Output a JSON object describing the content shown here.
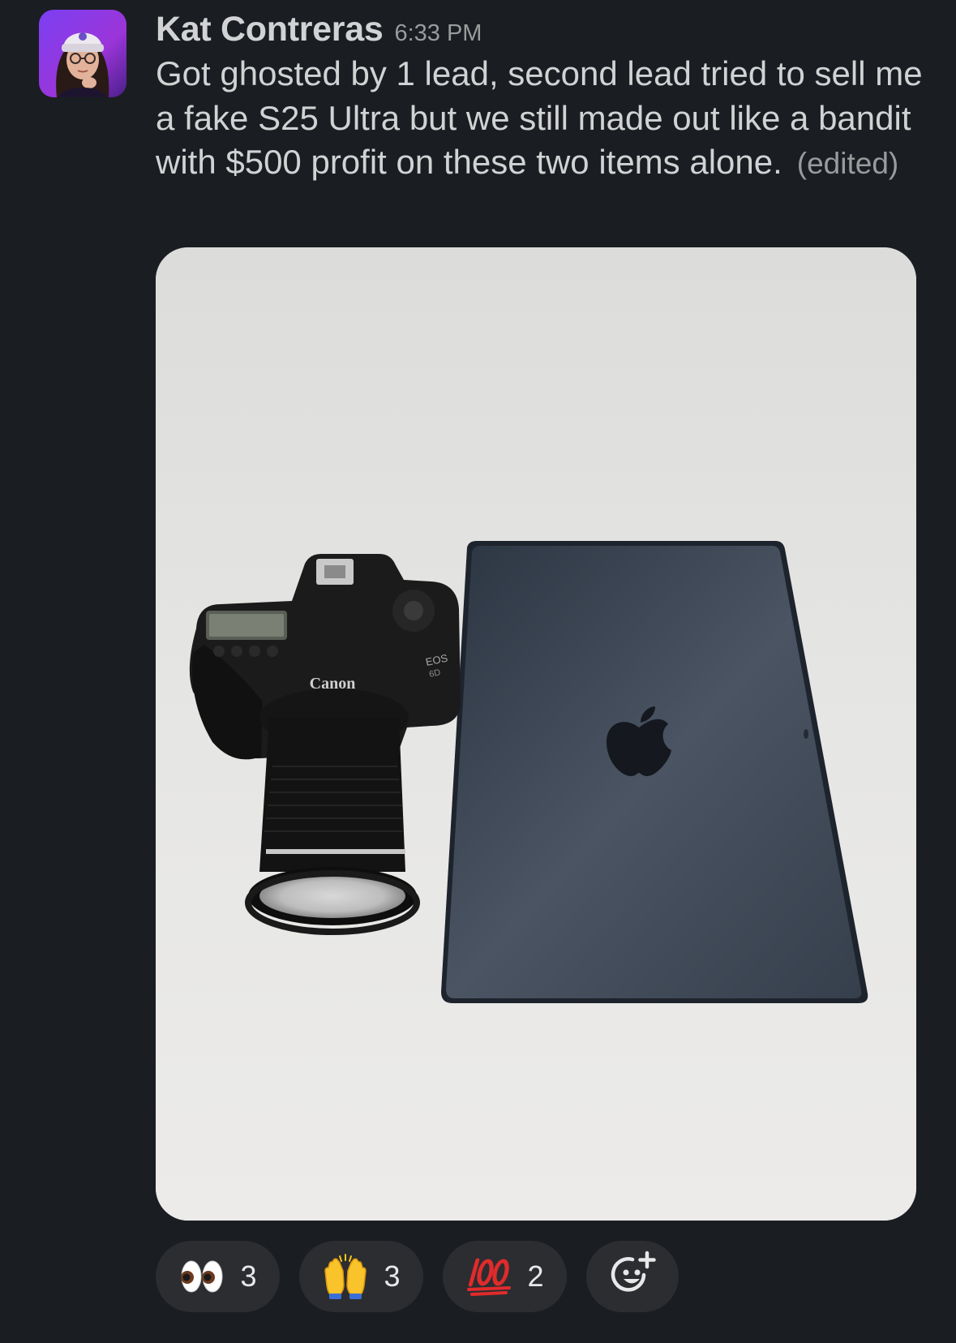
{
  "message": {
    "sender": "Kat Contreras",
    "timestamp": "6:33 PM",
    "text": "Got ghosted by 1 lead, second lead tried to sell me a fake S25 Ultra but we still made out like a bandit with $500 profit on these two items alone.",
    "edited_label": "(edited)"
  },
  "attachment": {
    "camera_brand": "Canon",
    "camera_model": "EOS",
    "camera_number": "6D"
  },
  "reactions": [
    {
      "emoji": "eyes-icon",
      "count": "3"
    },
    {
      "emoji": "raised-hands-icon",
      "count": "3"
    },
    {
      "emoji": "hundred-points-icon",
      "count": "2"
    }
  ],
  "colors": {
    "background": "#1a1d21",
    "text": "#d1d2d3",
    "muted": "#9a9b9d",
    "reaction_bg": "#2b2d31"
  }
}
